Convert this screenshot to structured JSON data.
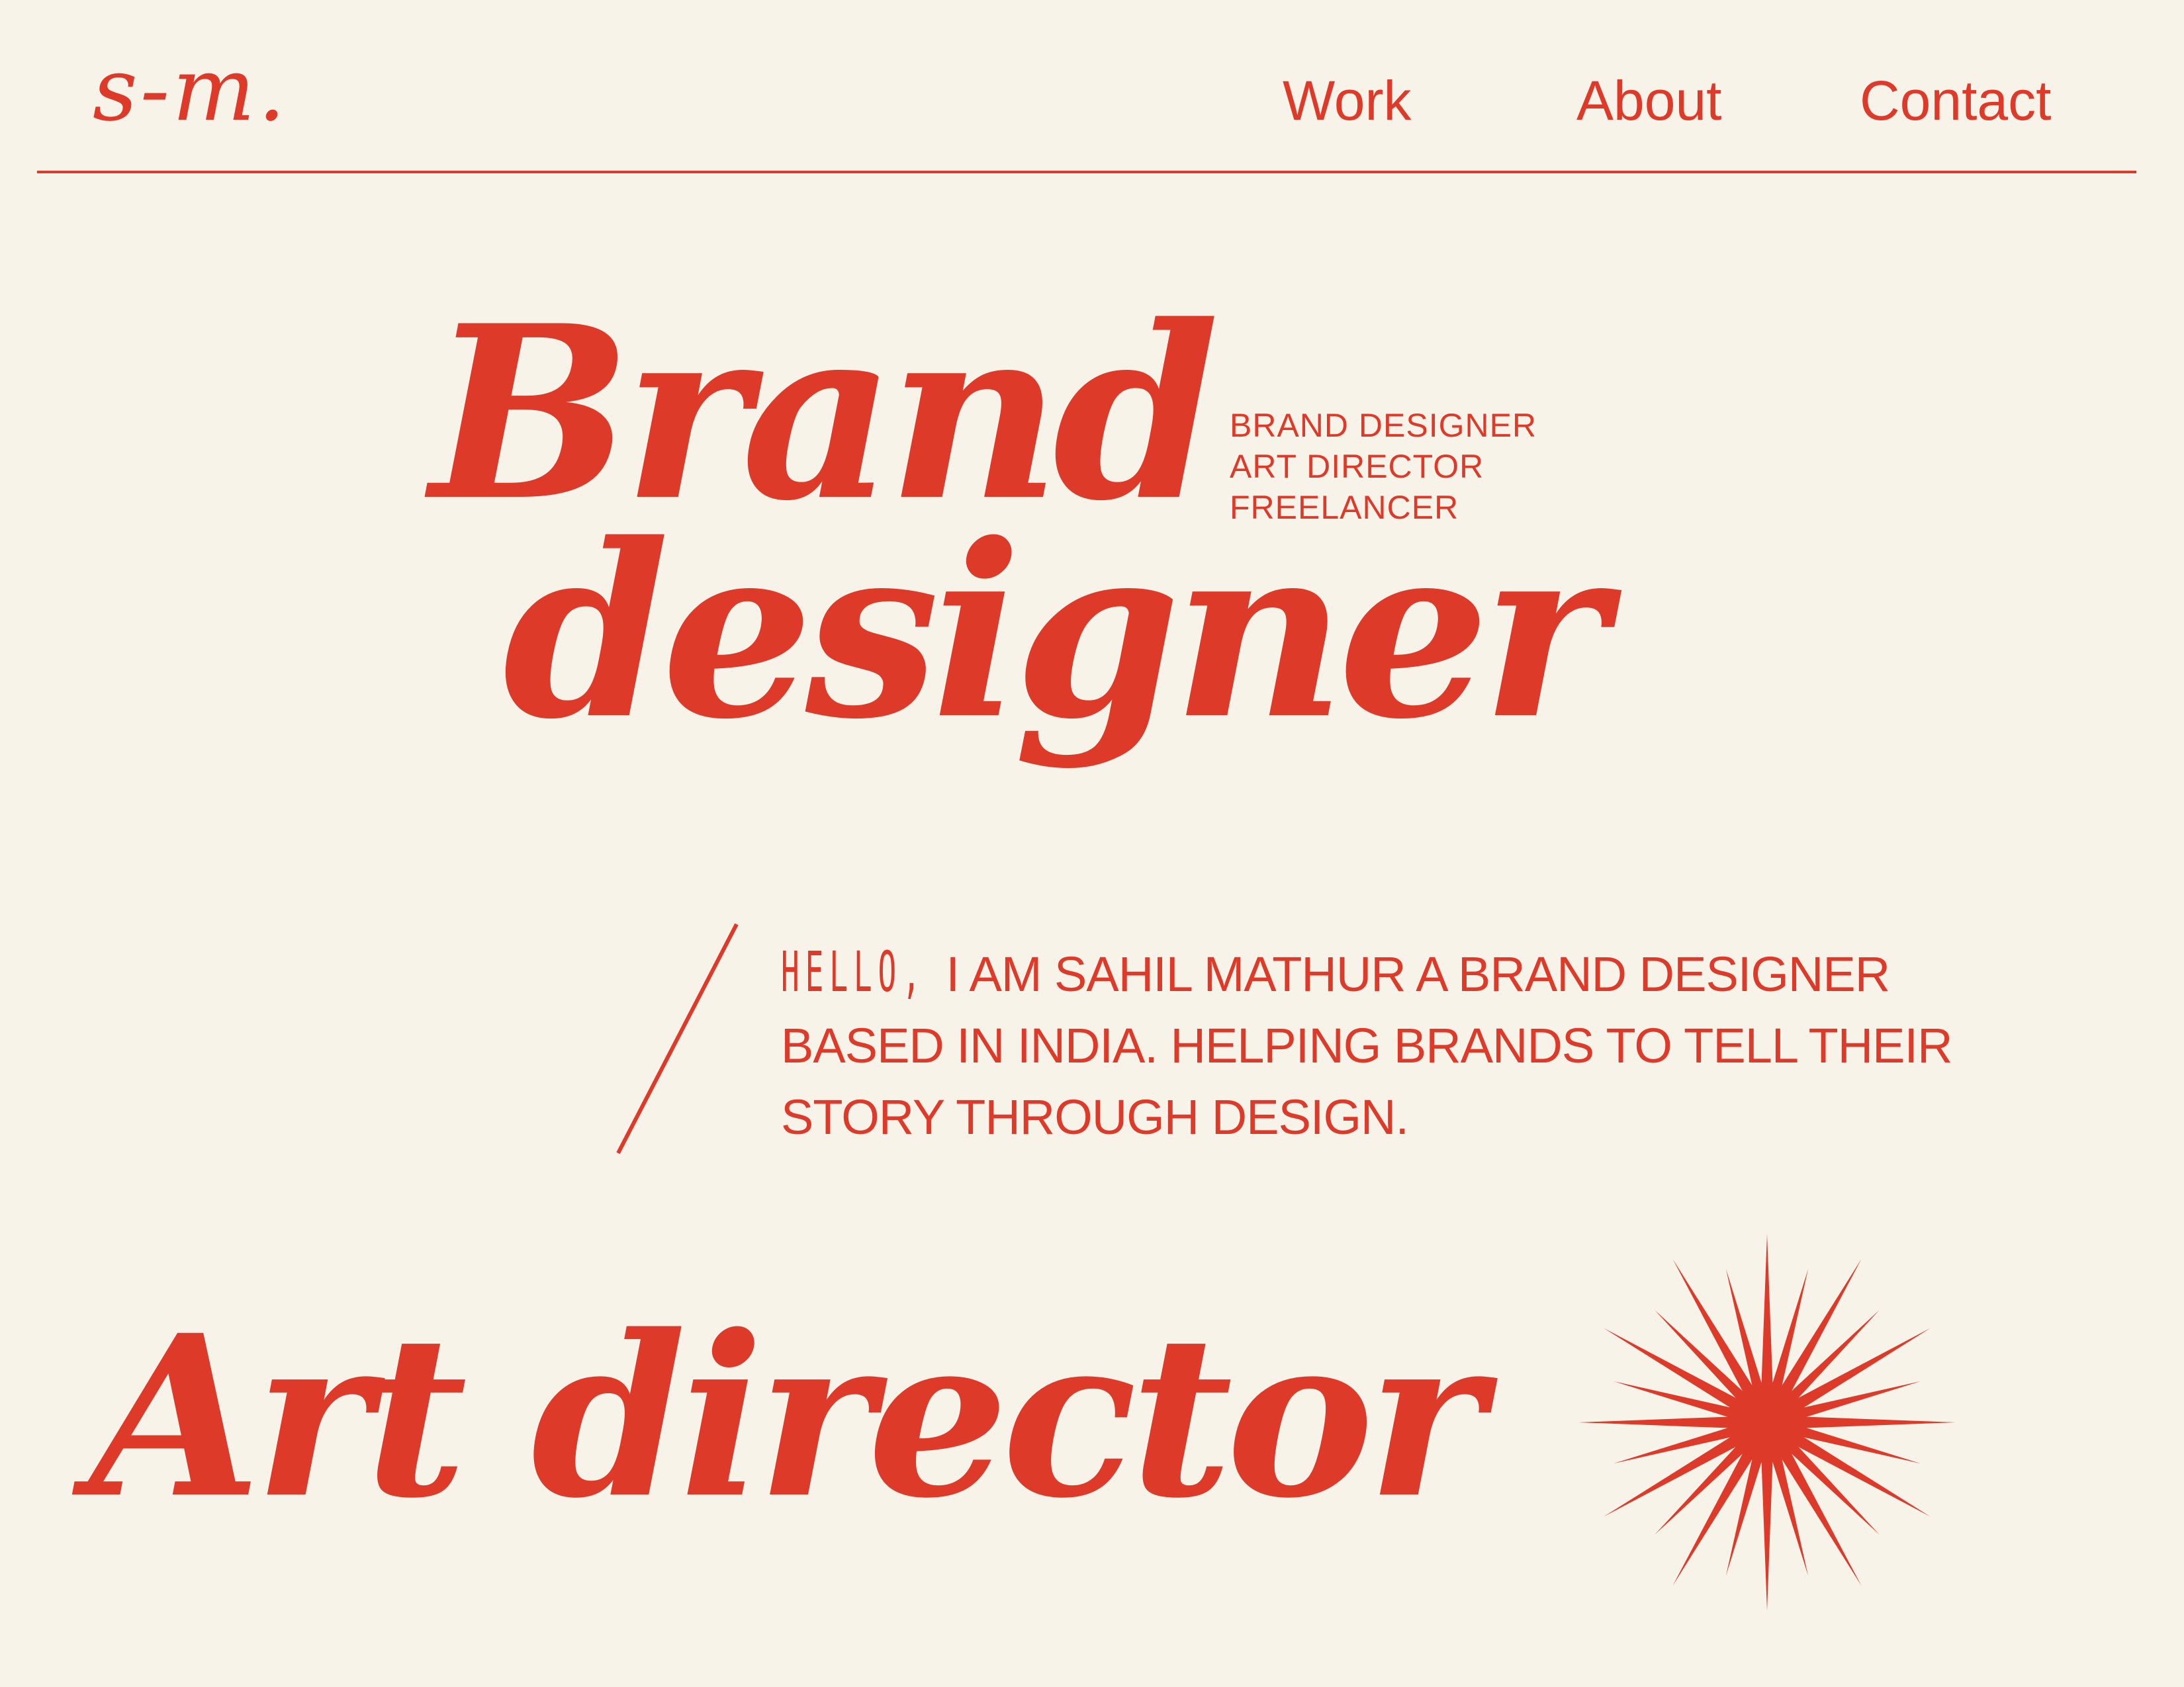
{
  "header": {
    "logo": "s-m.",
    "nav": [
      {
        "label": "Work"
      },
      {
        "label": "About"
      },
      {
        "label": "Contact"
      }
    ]
  },
  "hero": {
    "line1": "Brand",
    "line2": "designer",
    "roles": [
      "BRAND DESIGNER",
      "ART DIRECTOR",
      "FREELANCER"
    ]
  },
  "intro": {
    "greeting": "HELLO,",
    "text": "I AM SAHIL MATHUR A BRAND DESIGNER BASED IN INDIA. HELPING BRANDS TO TELL THEIR STORY THROUGH DESIGN."
  },
  "secondary": {
    "heading": "Art director"
  },
  "decor": {
    "star_icon": "starburst-icon",
    "slash_icon": "slash-divider"
  },
  "colors": {
    "background": "#f8f3e9",
    "accent": "#dd3a2a"
  }
}
